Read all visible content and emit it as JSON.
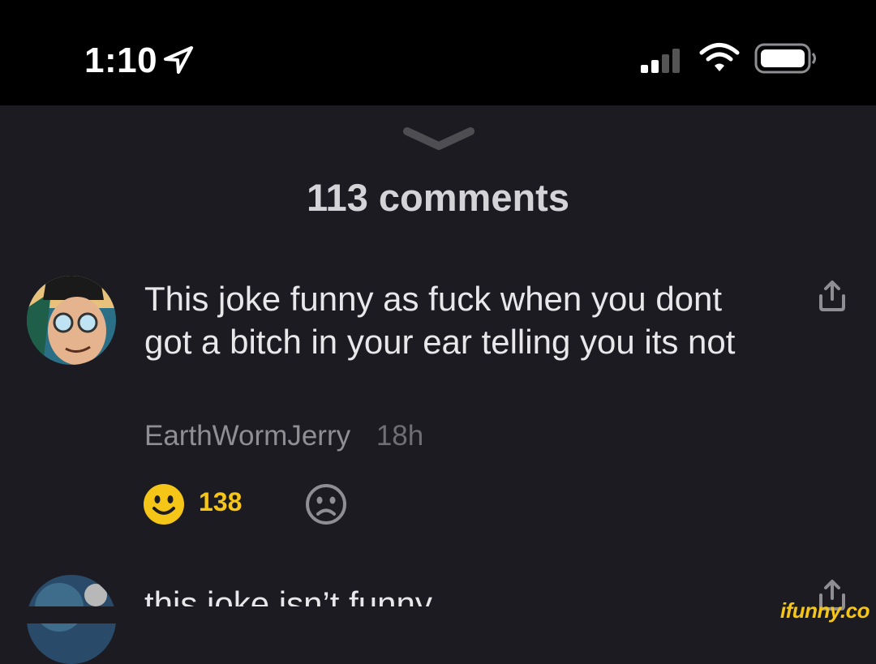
{
  "status_bar": {
    "time": "1:10"
  },
  "sheet": {
    "title": "113 comments"
  },
  "comments": [
    {
      "text": "This joke funny as fuck when you dont got a bitch in your ear telling you its not",
      "author": "EarthWormJerry",
      "time": "18h",
      "likes": "138"
    },
    {
      "text": "this joke isn’t funny"
    }
  ],
  "watermark": "ifunny.co",
  "colors": {
    "background": "#1c1b21",
    "status_bar": "#000000",
    "like_accent": "#f5c518",
    "muted_text": "#8e8e93"
  },
  "icons": [
    "location-arrow-icon",
    "signal-icon",
    "wifi-icon",
    "battery-icon",
    "chevron-down-icon",
    "share-icon",
    "smile-icon",
    "frown-icon"
  ]
}
